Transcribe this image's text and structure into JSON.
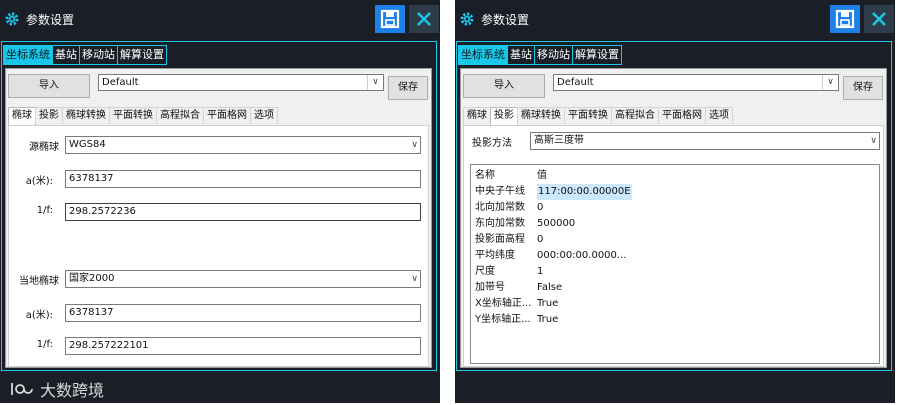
{
  "colors": {
    "window_bg": "#1a1e26",
    "accent_cyan": "#19c7e8",
    "save_icon_bg": "#1d80e6",
    "panel_bg": "#f0f0f0",
    "selection": "#cce8ff"
  },
  "left": {
    "title": "参数设置",
    "save_icon": "floppy-disk-icon",
    "close_icon": "close-icon",
    "main_tabs": [
      {
        "label": "坐标系统",
        "active": true
      },
      {
        "label": "基站",
        "active": false
      },
      {
        "label": "移动站",
        "active": false
      },
      {
        "label": "解算设置",
        "active": false
      }
    ],
    "import_label": "导入",
    "profile": "Default",
    "save_label": "保存",
    "sub_tabs": [
      {
        "label": "椭球",
        "active": true
      },
      {
        "label": "投影",
        "active": false
      },
      {
        "label": "椭球转换",
        "active": false
      },
      {
        "label": "平面转换",
        "active": false
      },
      {
        "label": "高程拟合",
        "active": false
      },
      {
        "label": "平面格网",
        "active": false
      },
      {
        "label": "选项",
        "active": false
      }
    ],
    "source_ellipsoid_label": "源椭球",
    "source_ellipsoid": "WGS84",
    "a_label": "a(米):",
    "source_a": "6378137",
    "f_label": "1/f:",
    "source_f": "298.2572236",
    "local_ellipsoid_label": "当地椭球",
    "local_ellipsoid": "国家2000",
    "local_a": "6378137",
    "local_f": "298.257222101"
  },
  "right": {
    "title": "参数设置",
    "main_tabs": [
      {
        "label": "坐标系统",
        "active": true
      },
      {
        "label": "基站",
        "active": false
      },
      {
        "label": "移动站",
        "active": false
      },
      {
        "label": "解算设置",
        "active": false
      }
    ],
    "import_label": "导入",
    "profile": "Default",
    "save_label": "保存",
    "sub_tabs": [
      {
        "label": "椭球",
        "active": false
      },
      {
        "label": "投影",
        "active": true
      },
      {
        "label": "椭球转换",
        "active": false
      },
      {
        "label": "平面转换",
        "active": false
      },
      {
        "label": "高程拟合",
        "active": false
      },
      {
        "label": "平面格网",
        "active": false
      },
      {
        "label": "选项",
        "active": false
      }
    ],
    "projection_label": "投影方法",
    "projection": "高斯三度带",
    "prop_header": {
      "key": "名称",
      "value": "值"
    },
    "props": [
      {
        "key": "中央子午线",
        "value": "117:00:00.00000E",
        "selected": true
      },
      {
        "key": "北向加常数",
        "value": "0"
      },
      {
        "key": "东向加常数",
        "value": "500000"
      },
      {
        "key": "投影面高程",
        "value": "0"
      },
      {
        "key": "平均纬度",
        "value": "000:00:00.0000..."
      },
      {
        "key": "尺度",
        "value": "1"
      },
      {
        "key": "加带号",
        "value": "False"
      },
      {
        "key": "X坐标轴正...",
        "value": "True"
      },
      {
        "key": "Y坐标轴正...",
        "value": "True"
      }
    ]
  },
  "watermark": "大数跨境"
}
